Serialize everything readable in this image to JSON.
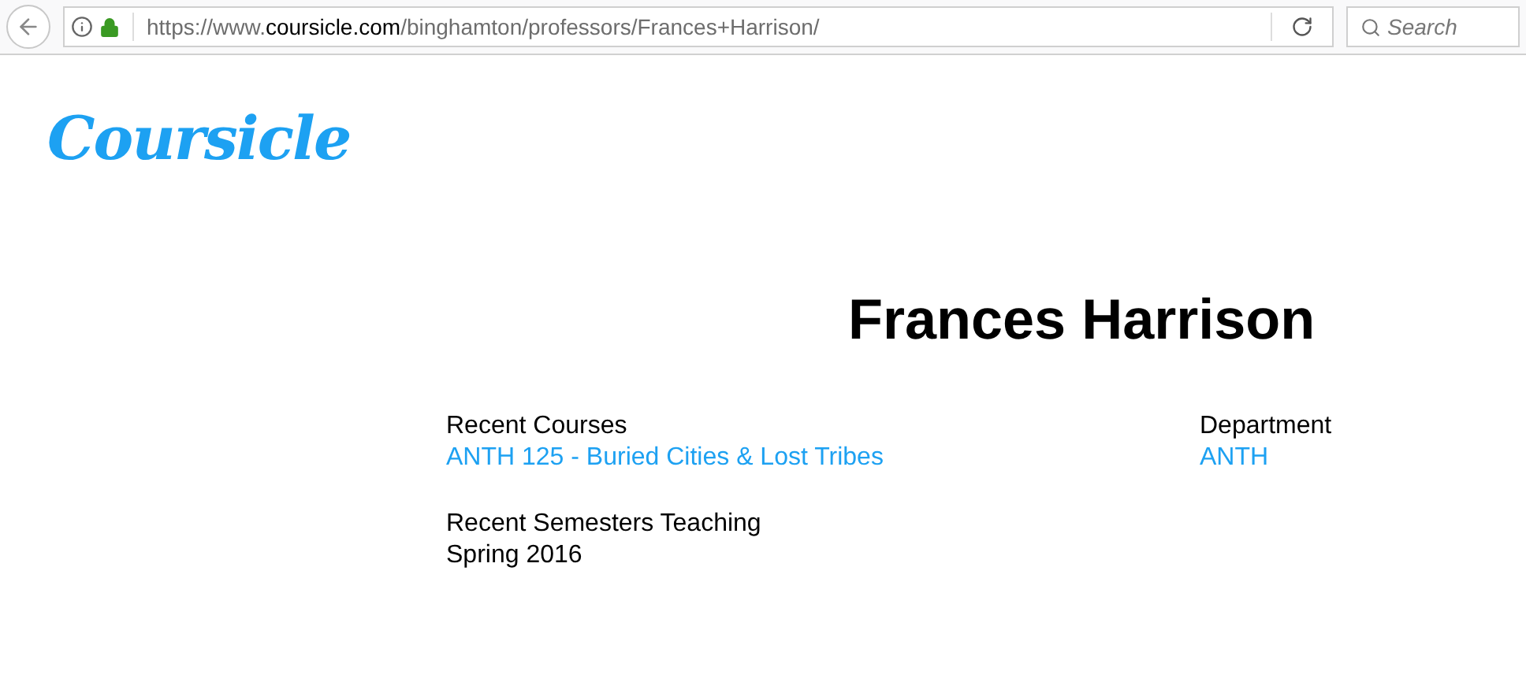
{
  "browser": {
    "url_parts": [
      {
        "text": "https://www.",
        "kind": "dim"
      },
      {
        "text": "coursicle.com",
        "kind": "host"
      },
      {
        "text": "/binghamton/professors/Frances+Harrison/",
        "kind": "dim"
      }
    ],
    "search": {
      "placeholder": "Search"
    }
  },
  "logo": "Coursicle",
  "professor": {
    "name": "Frances Harrison"
  },
  "recent_courses": {
    "label": "Recent Courses",
    "items": [
      "ANTH 125 - Buried Cities & Lost Tribes"
    ]
  },
  "department": {
    "label": "Department",
    "value": "ANTH"
  },
  "recent_semesters": {
    "label": "Recent Semesters Teaching",
    "items": [
      "Spring 2016"
    ]
  }
}
